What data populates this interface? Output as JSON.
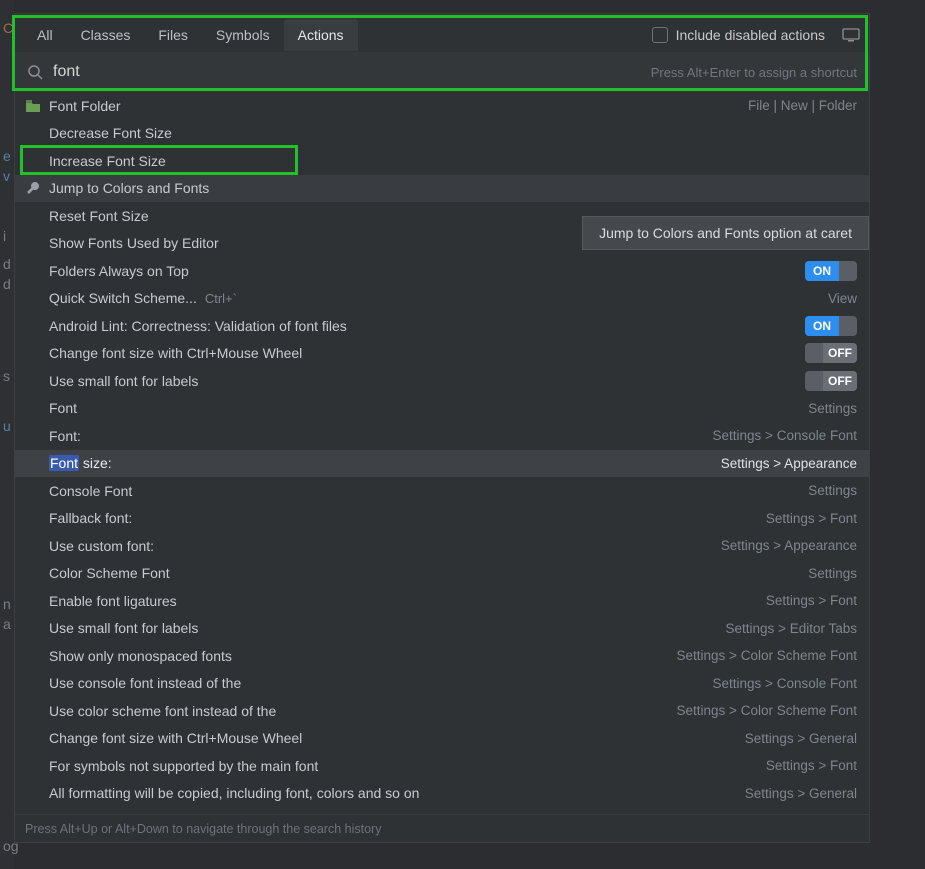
{
  "tabs": [
    "All",
    "Classes",
    "Files",
    "Symbols",
    "Actions"
  ],
  "active_tab": 4,
  "include_label": "Include disabled actions",
  "search_value": "font",
  "search_hint": "Press Alt+Enter to assign a shortcut",
  "tooltip": "Jump to Colors and Fonts option at caret",
  "footer_hint": "Press Alt+Up or Alt+Down to navigate through the search history",
  "rows": [
    {
      "icon": "folder",
      "label": "Font Folder",
      "right": "File | New | Folder"
    },
    {
      "label": "Decrease Font Size"
    },
    {
      "label": "Increase Font Size",
      "boxed": true
    },
    {
      "icon": "wrench",
      "label": "Jump to Colors and Fonts",
      "hovered": true
    },
    {
      "label": "Reset Font Size"
    },
    {
      "label": "Show Fonts Used by Editor"
    },
    {
      "label": "Folders Always on Top",
      "toggle": "on"
    },
    {
      "label": "Quick Switch Scheme...",
      "shortcut": "Ctrl+`",
      "right": "View"
    },
    {
      "label": "Android Lint: Correctness: Validation of font files",
      "toggle": "on"
    },
    {
      "label": "Change font size with Ctrl+Mouse Wheel",
      "toggle": "off"
    },
    {
      "label": "Use small font for labels",
      "toggle": "off"
    },
    {
      "label": "Font",
      "right": "Settings"
    },
    {
      "label": "Font:",
      "right": "Settings > Console Font"
    },
    {
      "label": "Font size:",
      "right": "Settings > Appearance",
      "selected": true,
      "highlight": "Font"
    },
    {
      "label": "Console Font",
      "right": "Settings"
    },
    {
      "label": "Fallback font:",
      "right": "Settings > Font"
    },
    {
      "label": "Use custom font:",
      "right": "Settings > Appearance"
    },
    {
      "label": "Color Scheme Font",
      "right": "Settings"
    },
    {
      "label": "Enable font ligatures",
      "right": "Settings > Font"
    },
    {
      "label": "Use small font for labels",
      "right": "Settings > Editor Tabs"
    },
    {
      "label": "Show only monospaced fonts",
      "right": "Settings > Color Scheme Font"
    },
    {
      "label": "Use console font instead of the",
      "right": "Settings > Console Font"
    },
    {
      "label": "Use color scheme font instead of the",
      "right": "Settings > Color Scheme Font"
    },
    {
      "label": "Change font size with Ctrl+Mouse Wheel",
      "right": "Settings > General"
    },
    {
      "label": "For symbols not supported by the main font",
      "right": "Settings > Font"
    },
    {
      "label": "All formatting will be copied, including font, colors and so on",
      "right": "Settings > General"
    }
  ]
}
